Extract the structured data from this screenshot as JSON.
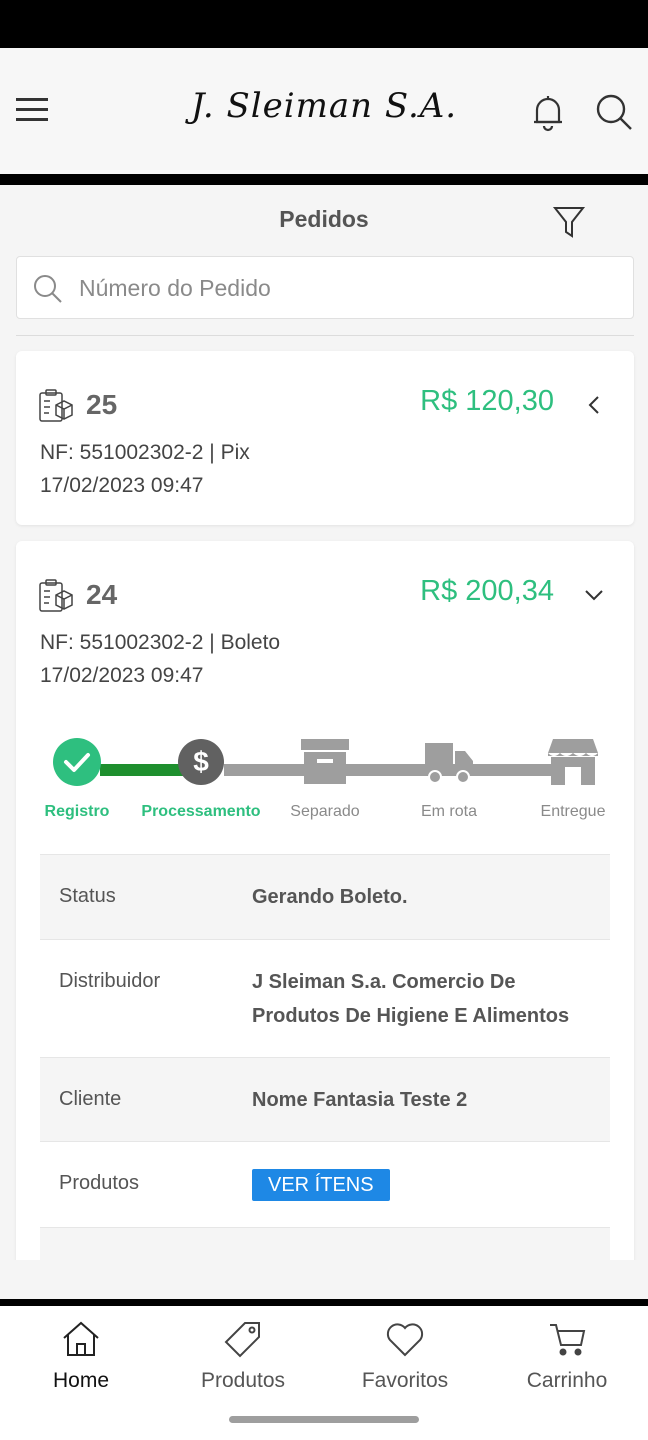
{
  "header": {
    "logo_text": "J. Sleiman S.A."
  },
  "page": {
    "title": "Pedidos"
  },
  "search": {
    "placeholder": "Número do Pedido",
    "value": ""
  },
  "orders": [
    {
      "number": "25",
      "total": "R$ 120,30",
      "nf_line": "NF: 551002302-2 | Pix",
      "date": "17/02/2023 09:47",
      "expanded": false
    },
    {
      "number": "24",
      "total": "R$ 200,34",
      "nf_line": "NF: 551002302-2 | Boleto",
      "date": "17/02/2023 09:47",
      "expanded": true,
      "steps": [
        {
          "label": "Registro",
          "state": "done",
          "icon": "check-icon"
        },
        {
          "label": "Processamento",
          "state": "done",
          "icon": "dollar-icon"
        },
        {
          "label": "Separado",
          "state": "pending",
          "icon": "box-icon"
        },
        {
          "label": "Em rota",
          "state": "pending",
          "icon": "truck-icon"
        },
        {
          "label": "Entregue",
          "state": "pending",
          "icon": "store-icon"
        }
      ],
      "details": {
        "status_label": "Status",
        "status_value": "Gerando Boleto.",
        "distributor_label": "Distribuidor",
        "distributor_value": "J Sleiman S.a. Comercio De Produtos De Higiene E Alimentos",
        "client_label": "Cliente",
        "client_value": "Nome Fantasia Teste 2",
        "products_label": "Produtos",
        "products_button": "VER ÍTENS"
      }
    }
  ],
  "nav": {
    "items": [
      {
        "label": "Home",
        "icon": "home-icon",
        "active": true
      },
      {
        "label": "Produtos",
        "icon": "tag-icon",
        "active": false
      },
      {
        "label": "Favoritos",
        "icon": "heart-icon",
        "active": false
      },
      {
        "label": "Carrinho",
        "icon": "cart-icon",
        "active": false
      }
    ]
  },
  "colors": {
    "accent_green": "#2ebf7f",
    "progress_green": "#1e8f2e",
    "link_blue": "#1e88e5",
    "pending_gray": "#9e9e9e"
  }
}
